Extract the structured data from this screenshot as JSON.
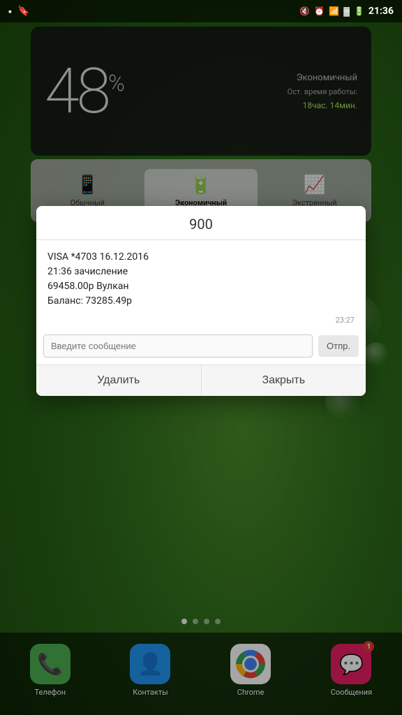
{
  "status_bar": {
    "time": "21:36",
    "icons_left": [
      "message-icon",
      "bookmark-icon"
    ],
    "icons_right": [
      "mute-icon",
      "alarm-icon",
      "wifi-icon",
      "signal-icon",
      "battery-icon"
    ]
  },
  "battery_widget": {
    "percent": "48",
    "percent_symbol": "%",
    "mode": "Экономичный",
    "remaining_label": "Ост. время работы:",
    "remaining_value": "18час. 14мин."
  },
  "mode_selector": {
    "modes": [
      {
        "label": "Обычный",
        "active": false
      },
      {
        "label": "Экономичный",
        "active": true
      },
      {
        "label": "Экстренный",
        "active": false
      }
    ]
  },
  "sms_dialog": {
    "title": "900",
    "message": " VISA *4703 16.12.2016\n21:36 зачисление\n69458.00р Вулкан\nБаланс: 73285.49р",
    "timestamp": "23:27",
    "input_placeholder": "Введите сообщение",
    "send_label": "Отпр.",
    "delete_label": "Удалить",
    "close_label": "Закрыть"
  },
  "nav_dots": {
    "count": 4,
    "active": 0
  },
  "app_dock": {
    "apps": [
      {
        "name": "phone",
        "label": "Телефон",
        "badge": null
      },
      {
        "name": "contacts",
        "label": "Контакты",
        "badge": null
      },
      {
        "name": "chrome",
        "label": "Chrome",
        "badge": null
      },
      {
        "name": "messages",
        "label": "Сообщения",
        "badge": "1"
      }
    ]
  }
}
